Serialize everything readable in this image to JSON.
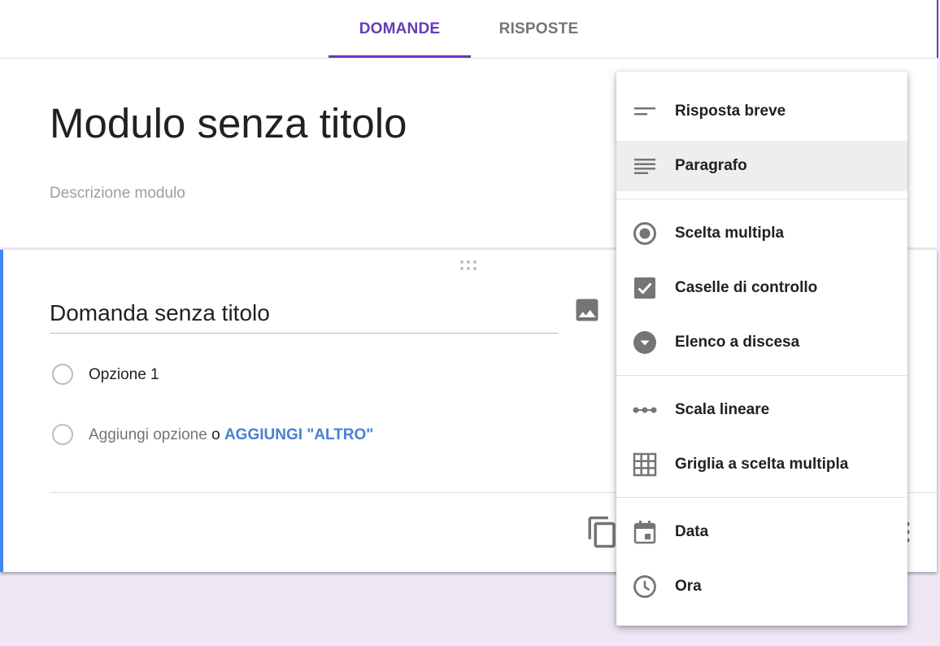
{
  "tabs": {
    "questions": "DOMANDE",
    "responses": "RISPOSTE"
  },
  "form": {
    "title": "Modulo senza titolo",
    "description_placeholder": "Descrizione modulo"
  },
  "question": {
    "title": "Domanda senza titolo",
    "options": [
      "Opzione 1"
    ],
    "add_option": "Aggiungi opzione",
    "or": "o",
    "add_other": "AGGIUNGI \"ALTRO\""
  },
  "menu": {
    "items": [
      {
        "label": "Risposta breve",
        "icon": "short-answer-icon"
      },
      {
        "label": "Paragrafo",
        "icon": "paragraph-icon"
      },
      {
        "label": "Scelta multipla",
        "icon": "radio-button-icon"
      },
      {
        "label": "Caselle di controllo",
        "icon": "checkbox-icon"
      },
      {
        "label": "Elenco a discesa",
        "icon": "dropdown-icon"
      },
      {
        "label": "Scala lineare",
        "icon": "linear-scale-icon"
      },
      {
        "label": "Griglia a scelta multipla",
        "icon": "grid-icon"
      },
      {
        "label": "Data",
        "icon": "calendar-icon"
      },
      {
        "label": "Ora",
        "icon": "clock-icon"
      }
    ]
  },
  "colors": {
    "primary": "#673ab7",
    "accent_blue": "#4285f4",
    "background": "#ede7f6",
    "icon_gray": "#757575"
  }
}
